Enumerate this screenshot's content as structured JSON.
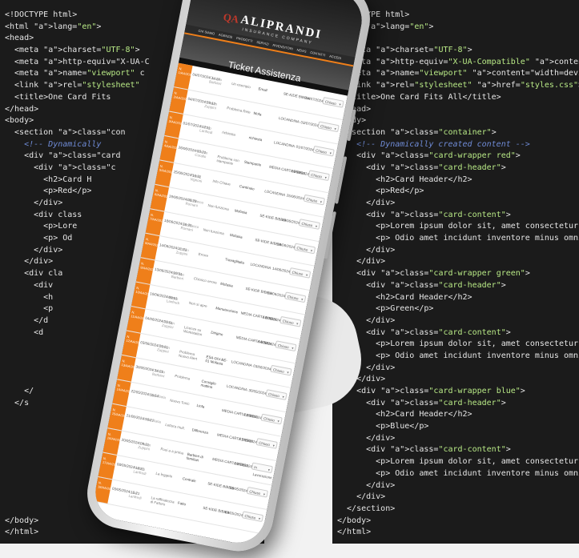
{
  "code_left": [
    "<!DOCTYPE html>",
    "<html lang=\"en\">",
    "<head>",
    "  <meta charset=\"UTF-8\">",
    "  <meta http-equiv=\"X-UA-C",
    "  <meta name=\"viewport\" c",
    "  <link rel=\"stylesheet\"",
    "  <title>One Card Fits",
    "</head>",
    "<body>",
    "  <section class=\"con",
    "    <!-- Dynamically",
    "    <div class=\"card",
    "      <div class=\"c",
    "        <h2>Card H",
    "        <p>Red</p>",
    "      </div>",
    "      <div class",
    "        <p>Lore",
    "        <p> Od",
    "      </div>",
    "    </div>",
    "    <div cla",
    "      <div",
    "        <h",
    "        <p",
    "      </d",
    "      <d",
    "",
    "",
    "",
    "",
    "    </",
    "  </s",
    "",
    "",
    "",
    "",
    "",
    "",
    "",
    "",
    "",
    "</body>",
    "</html>"
  ],
  "code_right": [
    "<!DOCTYPE html>",
    "<html lang=\"en\">",
    "<head>",
    "  <meta charset=\"UTF-8\">",
    "  <meta http-equiv=\"X-UA-Compatible\" content=\"IE=edge\">",
    "  <meta name=\"viewport\" content=\"width=device-width,",
    "  <link rel=\"stylesheet\" href=\"styles.css\">",
    "  <title>One Card Fits All</title>",
    "</head>",
    "<body>",
    "  <section class=\"container\">",
    "    <!-- Dynamically created content -->",
    "    <div class=\"card-wrapper red\">",
    "      <div class=\"card-header\">",
    "        <h2>Card Header</h2>",
    "        <p>Red</p>",
    "      </div>",
    "      <div class=\"card-content\">",
    "        <p>Lorem ipsum dolor sit, amet consectetur",
    "        <p> Odio amet incidunt inventore minus omnis",
    "      </div>",
    "    </div>",
    "    <div class=\"card-wrapper green\">",
    "      <div class=\"card-header\">",
    "        <h2>Card Header</h2>",
    "        <p>Green</p>",
    "      </div>",
    "      <div class=\"card-content\">",
    "        <p>Lorem ipsum dolor sit, amet consectetur",
    "        <p> Odio amet incidunt inventore minus omnis",
    "      </div>",
    "    </div>",
    "    <div class=\"card-wrapper blue\">",
    "      <div class=\"card-header\">",
    "        <h2>Card Header</h2>",
    "        <p>Blue</p>",
    "      </div>",
    "      <div class=\"card-content\">",
    "        <p>Lorem ipsum dolor sit, amet consectetur",
    "        <p> Odio amet incidunt inventore minus omnis",
    "      </div>",
    "    </div>",
    "  </section>",
    "</body>",
    "</html>"
  ],
  "phone": {
    "brand": "ALIPRANDI",
    "tagline": "INSURANCE COMPANY",
    "nav": [
      "CHI SIAMO",
      "AGENZIE",
      "PRODOTTI",
      "SERVIZI",
      "RIVENDITORI",
      "NEWS",
      "CONTATTI",
      "ACCEDI"
    ],
    "page_title": "Ticket Assistenza",
    "rows": [
      {
        "num": "N.\n1/AA/2024",
        "date": "04/07/2024 14:24",
        "name": "Claudio Barbieri",
        "desc": "Un esempio",
        "prod": "Email",
        "loc": "SE-KIDE BIBBIA",
        "d2": "04/07/2024",
        "status": "Chiuso"
      },
      {
        "num": "N.\n2/AA/2024",
        "date": "04/07/2024 09:12",
        "name": "Cristian Zuppini",
        "desc": "Problema Rete",
        "prod": "Mofa",
        "loc": "LOCANDINA",
        "d2": "03/07/2024",
        "status": "Chiuso"
      },
      {
        "num": "N.\n3/AA/2024",
        "date": "01/07/2024 17:11",
        "name": "Matteo Lanfredi",
        "desc": "richiesta",
        "prod": "richiesta",
        "loc": "LOCANDINA",
        "d2": "01/07/2024",
        "status": "Chiuso"
      },
      {
        "num": "N.\n4/AA/2024",
        "date": "26/06/2024 15:21",
        "name": "Antonio Corallo",
        "desc": "Problema con stampante",
        "prod": "Stampante",
        "loc": "MEDIA CARTA BIBBIA",
        "d2": "26/06/2024",
        "status": "Chiuso"
      },
      {
        "num": "N.\n5/AA/2024",
        "date": "25/06/2024 16:31",
        "name": "Paolo Vignoni",
        "desc": "Info Chiave",
        "prod": "Cantinaio",
        "loc": "LOCANDINA",
        "d2": "25/06/2024",
        "status": "Chiuso"
      },
      {
        "num": "N.\n6/AA/2024",
        "date": "19/06/2024 08:23",
        "name": "Gianfranco Romani",
        "desc": "Non funziona",
        "prod": "Mofasia",
        "loc": "SE-KIDE BIBBIA",
        "d2": "19/06/2024",
        "status": "Chiuso"
      },
      {
        "num": "N.\n7/AA/2024",
        "date": "18/06/2024 15:25",
        "name": "Gianfranco Romani",
        "desc": "Non funziona",
        "prod": "Mofasia",
        "loc": "SE-KIDE BIBBIA",
        "d2": "18/06/2024",
        "status": "Chiuso"
      },
      {
        "num": "N.\n8/AA/2024",
        "date": "14/06/2024 11:21",
        "name": "Cristian Zuppini",
        "desc": "Errore",
        "prod": "Travaglitalia",
        "loc": "LOCANDINA",
        "d2": "14/06/2024",
        "status": "Chiuso"
      },
      {
        "num": "N.\n9/AA/2024",
        "date": "13/06/2024 10:31",
        "name": "Stefano Barbieri",
        "desc": "Chiosco errore",
        "prod": "Mofasia",
        "loc": "SE-KIDE BIBBIA",
        "d2": "13/06/2024",
        "status": "Chiuso"
      },
      {
        "num": "N.\n10/AA/2024",
        "date": "10/06/2024 09:51",
        "name": "Matteo Lanfredi",
        "desc": "Non si apre",
        "prod": "Manutenzione",
        "loc": "MEDIA CARTA BIBBIA",
        "d2": "10/06/2024",
        "status": "Chiuso"
      },
      {
        "num": "N.\n11/AA/2024",
        "date": "04/06/2024 09:51",
        "name": "Cristian Zuppini",
        "desc": "Licenze su Workstation",
        "prod": "Dirigine",
        "loc": "MEDIA CARTA BIBBIA",
        "d2": "04/06/2024",
        "status": "Chiuso"
      },
      {
        "num": "N.\n12/AA/2024",
        "date": "03/06/2024 09:21",
        "name": "Cristian Zuppini",
        "desc": "Problema Nuovo Alert",
        "prod": "ESA-DIV-BE-01 Mofasia",
        "loc": "LOCANDINA",
        "d2": "03/06/2024",
        "status": "Chiuso"
      },
      {
        "num": "N.\n13/AA/2024",
        "date": "30/05/2024 14:21",
        "name": "Claudio Barbieri",
        "desc": "Problema",
        "prod": "Consiglio mattina",
        "loc": "LOCANDINA",
        "d2": "30/05/2024",
        "status": "Chiuso"
      },
      {
        "num": "N.\n14/AA/2024",
        "date": "22/05/2024 15:54",
        "name": "Iman Raria",
        "desc": "Nuovo Tonic",
        "prod": "Linfa",
        "loc": "MEDIA CARTA BIBBIA",
        "d2": "22/05/2024",
        "status": "Chiuso"
      },
      {
        "num": "N.\n15/AA/2024",
        "date": "21/05/2024 16:21",
        "name": "Iman Raria",
        "desc": "Lettura mult.",
        "prod": "Differenza",
        "loc": "MEDIA CARTA BIBBIA",
        "d2": "21/05/2024",
        "status": "Chiuso"
      },
      {
        "num": "N.\n16/AA/2024",
        "date": "20/05/2024 09:21",
        "name": "Cristian Zuppini",
        "desc": "Puoi a a prima",
        "prod": "Barbieri di familiari",
        "loc": "MEDIA CARTA BIBBIA",
        "d2": "20/05/2024",
        "status": "In Lavorazione"
      },
      {
        "num": "N.\n17/AA/2024",
        "date": "08/05/2024 16:21",
        "name": "Matteo Lanfredi",
        "desc": "La leggete",
        "prod": "Centrale",
        "loc": "SE-KIDE BIBBIA",
        "d2": "08/05/2024",
        "status": "Chiuso"
      },
      {
        "num": "N.\n18/AA/2024",
        "date": "03/05/2024 15:21",
        "name": "Luca Lanfredi",
        "desc": "La raffinatezza di Fattore",
        "prod": "Fatto",
        "loc": "SE-KIDE BIBBIA",
        "d2": "03/05/2024",
        "status": "Chiuso"
      }
    ]
  }
}
